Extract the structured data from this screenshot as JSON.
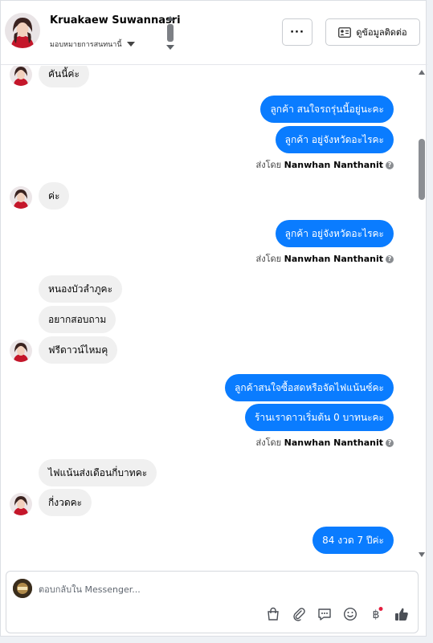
{
  "header": {
    "contact_name": "Kruakaew Suwannasri",
    "assign_label": "มอบหมายการสนทนานี้",
    "more_label": "···",
    "contact_info_label": "ดูข้อมูลติดต่อ"
  },
  "messages": {
    "m1": "คันนี้ค่ะ",
    "m2": "ลูกค้า สนใจรถรุ่นนี้อยู่นะคะ",
    "m3": "ลูกค้า อยู่จังหวัดอะไรคะ",
    "m4": "ค่ะ",
    "m5": "ลูกค้า อยู่จังหวัดอะไรคะ",
    "m6": "หนองบัวลำภูคะ",
    "m7": "อยากสอบถาม",
    "m8": "ฟรีดาวน์ไหมคุ",
    "m9": "ลูกค้าสนใจซื้อสดหรือจัดไฟแน้นซ์คะ",
    "m10": "ร้านเราดาวเริ่มต้น  0 บาทนะคะ",
    "m11": "ไฟแน้นส่งเดือนกี่บาทคะ",
    "m12": "กี่งวดคะ",
    "m13": "84 งวด  7 ปีค่ะ"
  },
  "sent_by": {
    "prefix": "ส่งโดย",
    "name": "Nanwhan Nanthanit"
  },
  "composer": {
    "placeholder": "ตอบกลับใน Messenger..."
  },
  "colors": {
    "outgoing_bubble": "#0a7cff",
    "incoming_bubble": "#f0f0f0",
    "notification_dot": "#e41e3f"
  },
  "icons": [
    "chevron-up-icon",
    "chevron-down-icon",
    "contact-card-icon",
    "shopping-bag-icon",
    "paperclip-icon",
    "saved-reply-icon",
    "emoji-icon",
    "baht-icon",
    "thumbs-up-icon"
  ]
}
